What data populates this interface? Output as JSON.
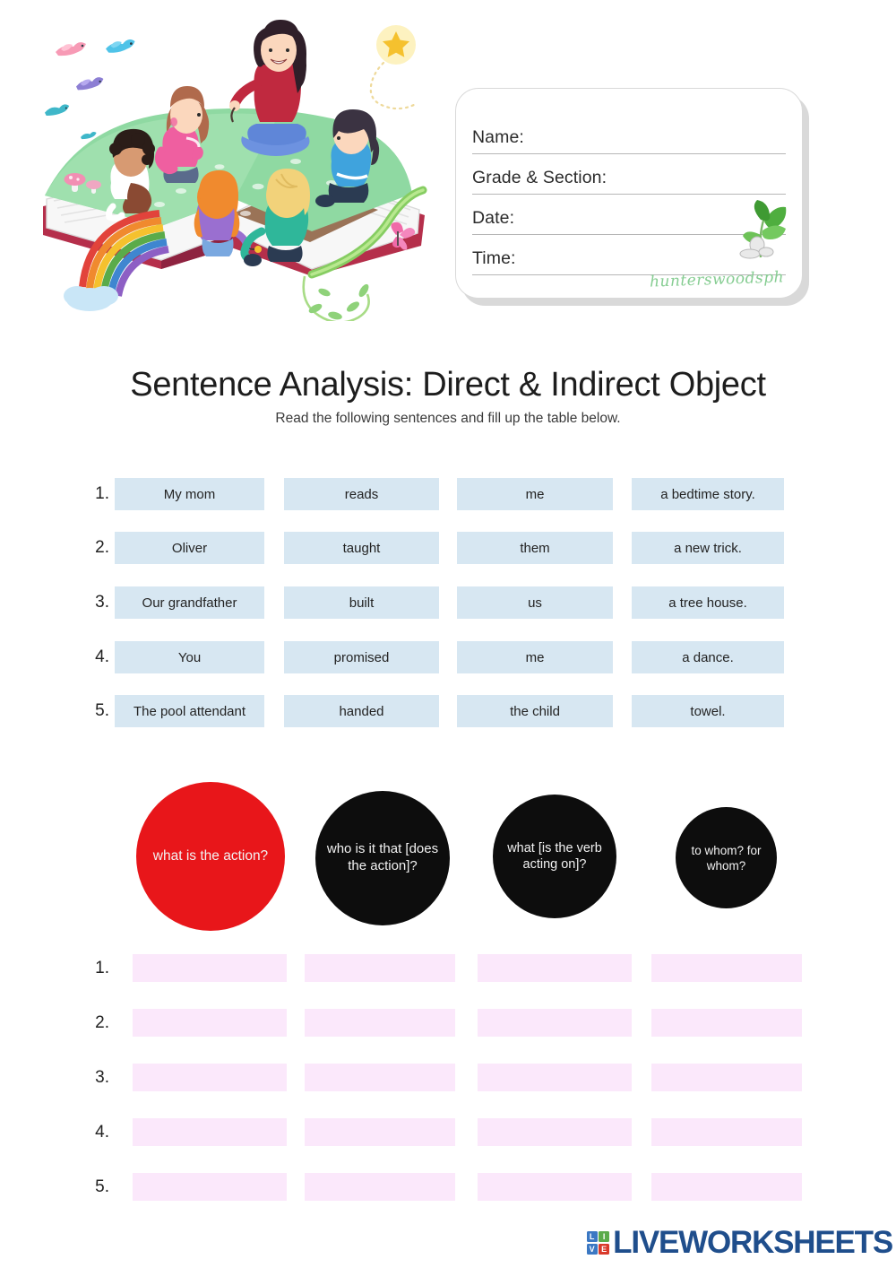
{
  "info_card": {
    "fields": [
      {
        "label": "Name:"
      },
      {
        "label": "Grade & Section:"
      },
      {
        "label": "Date:"
      },
      {
        "label": "Time:"
      }
    ],
    "brand": "hunterswoodsph",
    "brand_color": "#86cd92"
  },
  "header": {
    "title": "Sentence Analysis: Direct & Indirect Object",
    "subtitle": "Read the following sentences and fill up the table below."
  },
  "sentence_table": {
    "rows": [
      {
        "num": "1.",
        "c1": "My mom",
        "c2": "reads",
        "c3": "me",
        "c4": "a bedtime story."
      },
      {
        "num": "2.",
        "c1": "Oliver",
        "c2": "taught",
        "c3": "them",
        "c4": "a new trick."
      },
      {
        "num": "3.",
        "c1": "Our grandfather",
        "c2": "built",
        "c3": "us",
        "c4": "a tree house."
      },
      {
        "num": "4.",
        "c1": "You",
        "c2": "promised",
        "c3": "me",
        "c4": "a dance."
      },
      {
        "num": "5.",
        "c1": "The pool attendant",
        "c2": "handed",
        "c3": "the child",
        "c4": "towel."
      }
    ],
    "cell_color": "#d7e7f2"
  },
  "question_circles": [
    {
      "text": "what is the action?",
      "color": "#e8161a"
    },
    {
      "text": "who is it that [does the action]?",
      "color": "#0d0d0d"
    },
    {
      "text": "what [is the verb acting on]?",
      "color": "#0d0d0d"
    },
    {
      "text": "to whom? for whom?",
      "color": "#0d0d0d"
    }
  ],
  "answer_table": {
    "rows": [
      {
        "num": "1.",
        "c1": "",
        "c2": "",
        "c3": "",
        "c4": ""
      },
      {
        "num": "2.",
        "c1": "",
        "c2": "",
        "c3": "",
        "c4": ""
      },
      {
        "num": "3.",
        "c1": "",
        "c2": "",
        "c3": "",
        "c4": ""
      },
      {
        "num": "4.",
        "c1": "",
        "c2": "",
        "c3": "",
        "c4": ""
      },
      {
        "num": "5.",
        "c1": "",
        "c2": "",
        "c3": "",
        "c4": ""
      }
    ],
    "cell_color": "#fbe8fb"
  },
  "footer": {
    "logo_blocks": [
      "LI",
      "VE"
    ],
    "logo_letters": {
      "l": "L",
      "i": "I",
      "v": "V",
      "e": "E"
    },
    "logo_word": "LIVEWORKSHEETS",
    "logo_color": "#1f4e8c"
  }
}
